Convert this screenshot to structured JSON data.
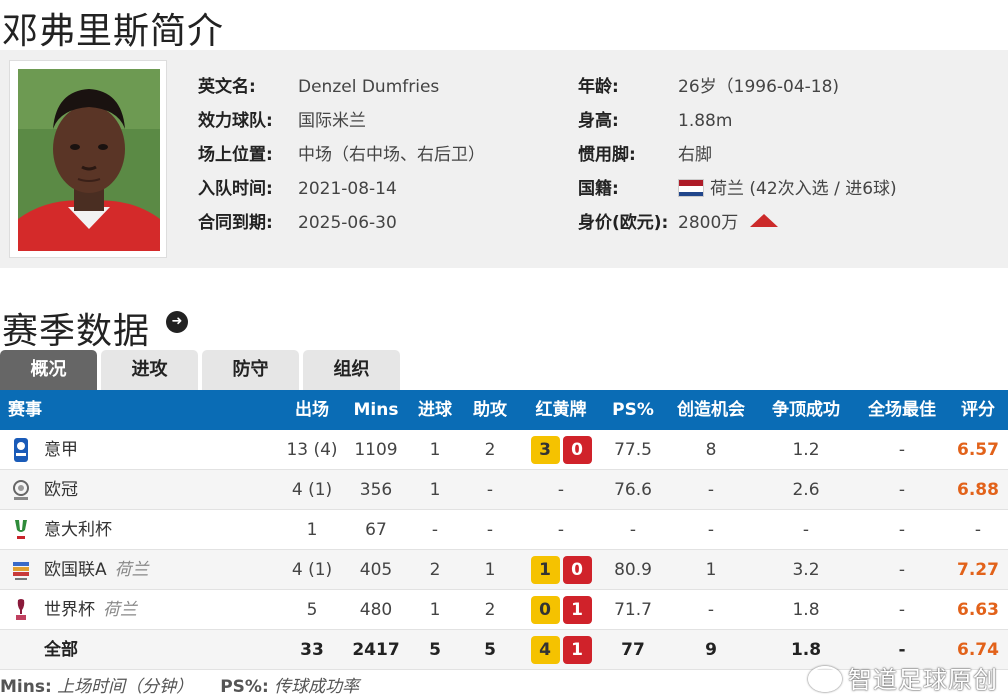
{
  "page_title": "邓弗里斯简介",
  "profile": {
    "photo_alt": "",
    "left_fields": [
      {
        "label": "英文名:",
        "value": "Denzel Dumfries"
      },
      {
        "label": "效力球队:",
        "value": "国际米兰"
      },
      {
        "label": "场上位置:",
        "value": "中场（右中场、右后卫）"
      },
      {
        "label": "入队时间:",
        "value": "2021-08-14"
      },
      {
        "label": "合同到期:",
        "value": "2025-06-30"
      }
    ],
    "right_fields": [
      {
        "label": "年龄:",
        "value": "26岁（1996-04-18)"
      },
      {
        "label": "身高:",
        "value": "1.88m"
      },
      {
        "label": "惯用脚:",
        "value": "右脚"
      },
      {
        "label": "国籍:",
        "value": "荷兰 (42次入选 / 进6球)"
      },
      {
        "label": "身价(欧元):",
        "value": "2800万"
      }
    ],
    "market_trend": "up",
    "flag_colors": [
      "#ae1c28",
      "#ffffff",
      "#21468b"
    ]
  },
  "section_title": "赛季数据",
  "tabs": [
    {
      "label": "概况",
      "active": true
    },
    {
      "label": "进攻",
      "active": false
    },
    {
      "label": "防守",
      "active": false
    },
    {
      "label": "组织",
      "active": false
    }
  ],
  "table": {
    "headers": [
      "赛事",
      "出场",
      "Mins",
      "进球",
      "助攻",
      "红黄牌",
      "PS%",
      "创造机会",
      "争顶成功",
      "全场最佳",
      "评分"
    ],
    "rows": [
      {
        "comp": "意甲",
        "team": "",
        "icon": "serie-a-icon",
        "apps": "13 (4)",
        "mins": "1109",
        "goals": "1",
        "assists": "2",
        "yellow": "3",
        "red": "0",
        "ps": "77.5",
        "chances": "8",
        "aerials": "1.2",
        "motm": "-",
        "rating": "6.57"
      },
      {
        "comp": "欧冠",
        "team": "",
        "icon": "champions-league-icon",
        "apps": "4 (1)",
        "mins": "356",
        "goals": "1",
        "assists": "-",
        "yellow": "",
        "red": "",
        "cards_text": "-",
        "ps": "76.6",
        "chances": "-",
        "aerials": "2.6",
        "motm": "-",
        "rating": "6.88"
      },
      {
        "comp": "意大利杯",
        "team": "",
        "icon": "coppa-italia-icon",
        "apps": "1",
        "mins": "67",
        "goals": "-",
        "assists": "-",
        "yellow": "",
        "red": "",
        "cards_text": "-",
        "ps": "-",
        "chances": "-",
        "aerials": "-",
        "motm": "-",
        "rating": "-"
      },
      {
        "comp": "欧国联A",
        "team": "荷兰",
        "icon": "nations-league-icon",
        "apps": "4 (1)",
        "mins": "405",
        "goals": "2",
        "assists": "1",
        "yellow": "1",
        "red": "0",
        "ps": "80.9",
        "chances": "1",
        "aerials": "3.2",
        "motm": "-",
        "rating": "7.27"
      },
      {
        "comp": "世界杯",
        "team": "荷兰",
        "icon": "world-cup-icon",
        "apps": "5",
        "mins": "480",
        "goals": "1",
        "assists": "2",
        "yellow": "0",
        "red": "1",
        "ps": "71.7",
        "chances": "-",
        "aerials": "1.8",
        "motm": "-",
        "rating": "6.63"
      }
    ],
    "total": {
      "comp": "全部",
      "apps": "33",
      "mins": "2417",
      "goals": "5",
      "assists": "5",
      "yellow": "4",
      "red": "1",
      "ps": "77",
      "chances": "9",
      "aerials": "1.8",
      "motm": "-",
      "rating": "6.74"
    }
  },
  "footnote": {
    "mins_key": "Mins:",
    "mins_desc": "上场时间（分钟）",
    "ps_key": "PS%:",
    "ps_desc": "传球成功率"
  },
  "watermark": "智道足球原创"
}
